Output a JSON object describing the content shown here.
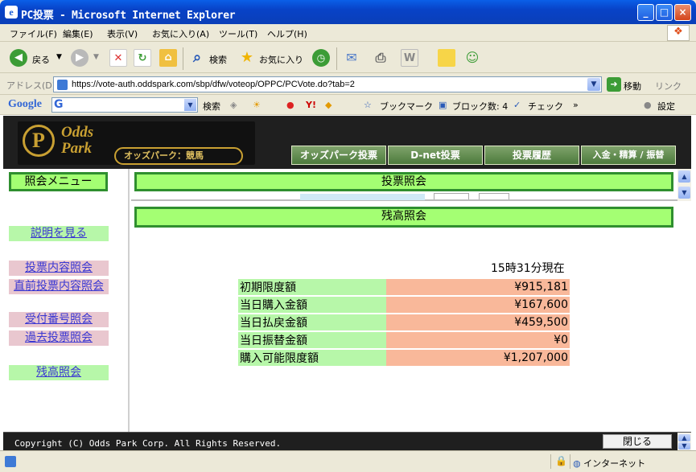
{
  "window": {
    "title": "PC投票 - Microsoft Internet Explorer"
  },
  "menubar": {
    "items": [
      "ファイル(F)",
      "編集(E)",
      "表示(V)",
      "お気に入り(A)",
      "ツール(T)",
      "ヘルプ(H)"
    ]
  },
  "toolbar": {
    "back": "戻る",
    "search": "検索",
    "favorites": "お気に入り"
  },
  "address": {
    "label": "アドレス(D)",
    "url": "https://vote-auth.oddspark.com/sbp/dfw/voteop/OPPC/PCVote.do?tab=2",
    "go": "移動",
    "links": "リンク"
  },
  "googlebar": {
    "logo": "Google",
    "search": "検索",
    "bookmarks": "ブックマーク",
    "block": "ブロック数: 4",
    "check": "チェック",
    "settings": "設定"
  },
  "site": {
    "brand": "Odds\nPark",
    "sub": "オッズパーク：競馬",
    "nav": [
      "オッズパーク投票",
      "D-net投票",
      "投票履歴",
      "入金・精算 / 振替"
    ]
  },
  "sidebar": {
    "title": "照会メニュー",
    "help": "説明を見る",
    "items": [
      "投票内容照会",
      "直前投票内容照会",
      "受付番号照会",
      "過去投票照会"
    ],
    "balance": "残高照会"
  },
  "top_frame": {
    "title": "投票照会"
  },
  "balance": {
    "title": "残高照会",
    "as_of": "15時31分現在",
    "rows": [
      {
        "label": "初期限度額",
        "value": "¥915,181"
      },
      {
        "label": "当日購入金額",
        "value": "¥167,600"
      },
      {
        "label": "当日払戻金額",
        "value": "¥459,500"
      },
      {
        "label": "当日振替金額",
        "value": "¥0"
      },
      {
        "label": "購入可能限度額",
        "value": "¥1,207,000"
      }
    ]
  },
  "footer": {
    "copyright": "Copyright (C) Odds Park Corp. All Rights Reserved.",
    "close": "閉じる"
  },
  "status": {
    "zone": "インターネット"
  }
}
